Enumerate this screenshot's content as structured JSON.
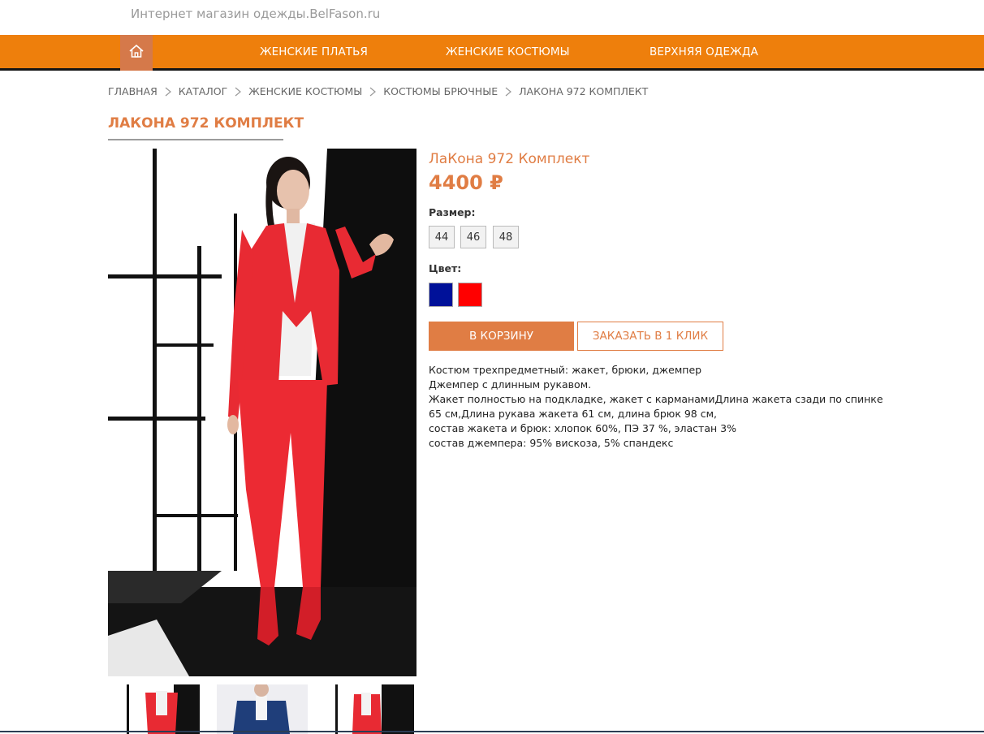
{
  "site": {
    "title": "Интернет магазин одежды.BelFason.ru"
  },
  "nav": {
    "home_icon": "home-icon",
    "items": [
      {
        "label": "ЖЕНСКИЕ ПЛАТЬЯ"
      },
      {
        "label": "ЖЕНСКИЕ КОСТЮМЫ"
      },
      {
        "label": "ВЕРХНЯЯ ОДЕЖДА"
      }
    ]
  },
  "breadcrumb": {
    "items": [
      {
        "label": "ГЛАВНАЯ"
      },
      {
        "label": "КАТАЛОГ"
      },
      {
        "label": "ЖЕНСКИЕ КОСТЮМЫ"
      },
      {
        "label": "КОСТЮМЫ БРЮЧНЫЕ"
      },
      {
        "label": "ЛАКОНА 972 КОМПЛЕКТ"
      }
    ]
  },
  "page": {
    "title": "ЛАКОНА 972 КОМПЛЕКТ"
  },
  "product": {
    "name": "ЛаКона 972 Комплект",
    "price": "4400 ₽",
    "size_label": "Размер:",
    "sizes": [
      "44",
      "46",
      "48"
    ],
    "color_label": "Цвет:",
    "colors": [
      "#001199",
      "#ff0000"
    ],
    "add_to_cart": "В КОРЗИНУ",
    "one_click": "ЗАКАЗАТЬ В 1 КЛИК",
    "description": [
      "Костюм трехпредметный: жакет, брюки, джемпер",
      "Джемпер с длинным рукавом.",
      "Жакет полностью на подкладке, жакет с карманамиДлина жакета сзади по спинке",
      "65 см,Длина рукава жакета 61 см, длина брюк 98 см,",
      "состав жакета и брюк: хлопок 60%, ПЭ 37 %, эластан 3%",
      "состав джемпера: 95% вискоза, 5% спандекс"
    ]
  },
  "accent_color": "#ee7f0c",
  "brand_color": "#e07d44"
}
